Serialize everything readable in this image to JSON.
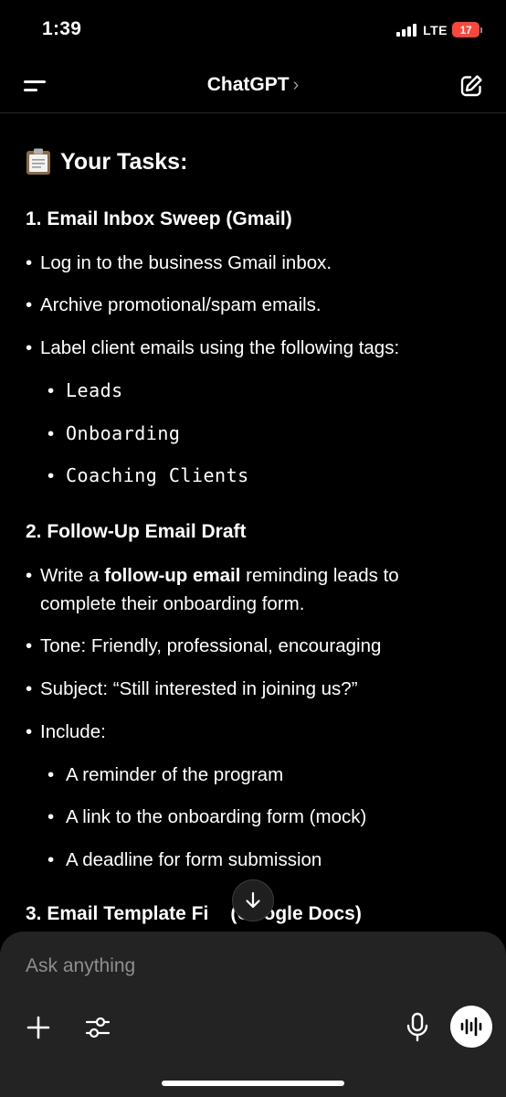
{
  "status": {
    "time": "1:39",
    "network": "LTE",
    "battery": "17"
  },
  "nav": {
    "title": "ChatGPT",
    "chevron": "›"
  },
  "message": {
    "heading": "Your Tasks:",
    "section1": {
      "title": "1. Email Inbox Sweep (Gmail)",
      "bullets": [
        "Log in to the business Gmail inbox.",
        "Archive promotional/spam emails.",
        "Label client emails using the following tags:"
      ],
      "tags": [
        "Leads",
        "Onboarding",
        "Coaching Clients"
      ]
    },
    "section2": {
      "title": "2. Follow-Up Email Draft",
      "write_pre": "Write a ",
      "write_bold": "follow-up email",
      "write_post": " reminding leads to",
      "write_line2": "complete their onboarding form.",
      "tone": "Tone: Friendly, professional, encouraging",
      "subject": "Subject: “Still interested in joining us?”",
      "include": "Include:",
      "include_items": [
        "A reminder of the program",
        "A link to the onboarding form (mock)",
        "A deadline for form submission"
      ]
    },
    "section3": {
      "title_left": "3. Email Template Fi",
      "title_right": "(Google Docs)"
    }
  },
  "composer": {
    "placeholder": "Ask anything"
  },
  "icons": {
    "menu": "menu-icon",
    "edit": "new-chat-icon",
    "clipboard": "clipboard-icon",
    "scroll": "arrow-down-icon",
    "plus": "plus-icon",
    "tools": "sliders-icon",
    "mic": "microphone-icon",
    "voice": "voice-waveform-icon"
  },
  "colors": {
    "background": "#000000",
    "composer": "#232323",
    "battery": "#ff453a"
  }
}
